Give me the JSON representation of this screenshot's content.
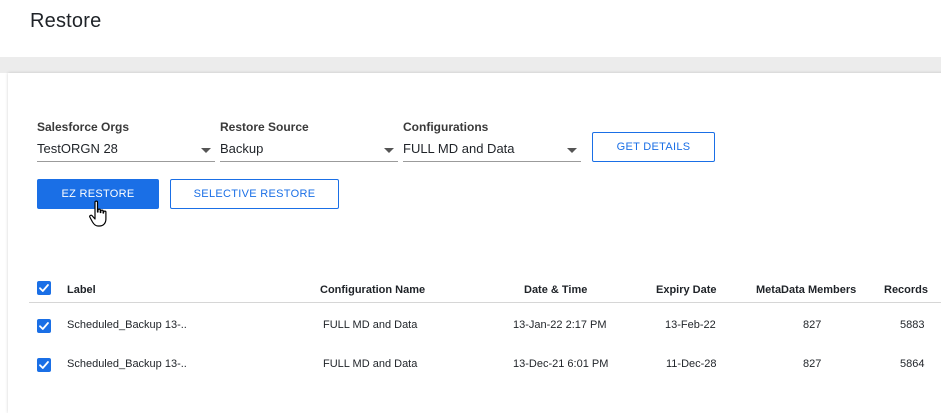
{
  "page": {
    "title": "Restore"
  },
  "filters": {
    "salesforce_orgs": {
      "label": "Salesforce Orgs",
      "value": "TestORGN 28"
    },
    "restore_source": {
      "label": "Restore Source",
      "value": "Backup"
    },
    "configurations": {
      "label": "Configurations",
      "value": "FULL MD and Data"
    },
    "get_details_label": "GET DETAILS"
  },
  "actions": {
    "ez_restore_label": "EZ RESTORE",
    "selective_restore_label": "SELECTIVE RESTORE"
  },
  "table": {
    "headers": {
      "label": "Label",
      "configuration_name": "Configuration Name",
      "date_time": "Date & Time",
      "expiry_date": "Expiry Date",
      "metadata_members": "MetaData Members",
      "records": "Records"
    },
    "select_all_checked": true,
    "rows": [
      {
        "checked": true,
        "label": "Scheduled_Backup 13-..",
        "configuration_name": "FULL MD and Data",
        "date_time": "13-Jan-22 2:17 PM",
        "expiry_date": "13-Feb-22",
        "metadata_members": "827",
        "records": "5883"
      },
      {
        "checked": true,
        "label": "Scheduled_Backup 13-..",
        "configuration_name": "FULL MD and Data",
        "date_time": "13-Dec-21 6:01 PM",
        "expiry_date": "11-Dec-28",
        "metadata_members": "827",
        "records": "5864"
      }
    ]
  },
  "colors": {
    "accent": "#1a6fe6",
    "background": "#ffffff",
    "band": "#ececec",
    "text": "#1f2328"
  },
  "icons": {
    "checkbox": "checkmark-icon",
    "dropdown": "caret-down-icon",
    "cursor": "hand-pointer-icon"
  }
}
